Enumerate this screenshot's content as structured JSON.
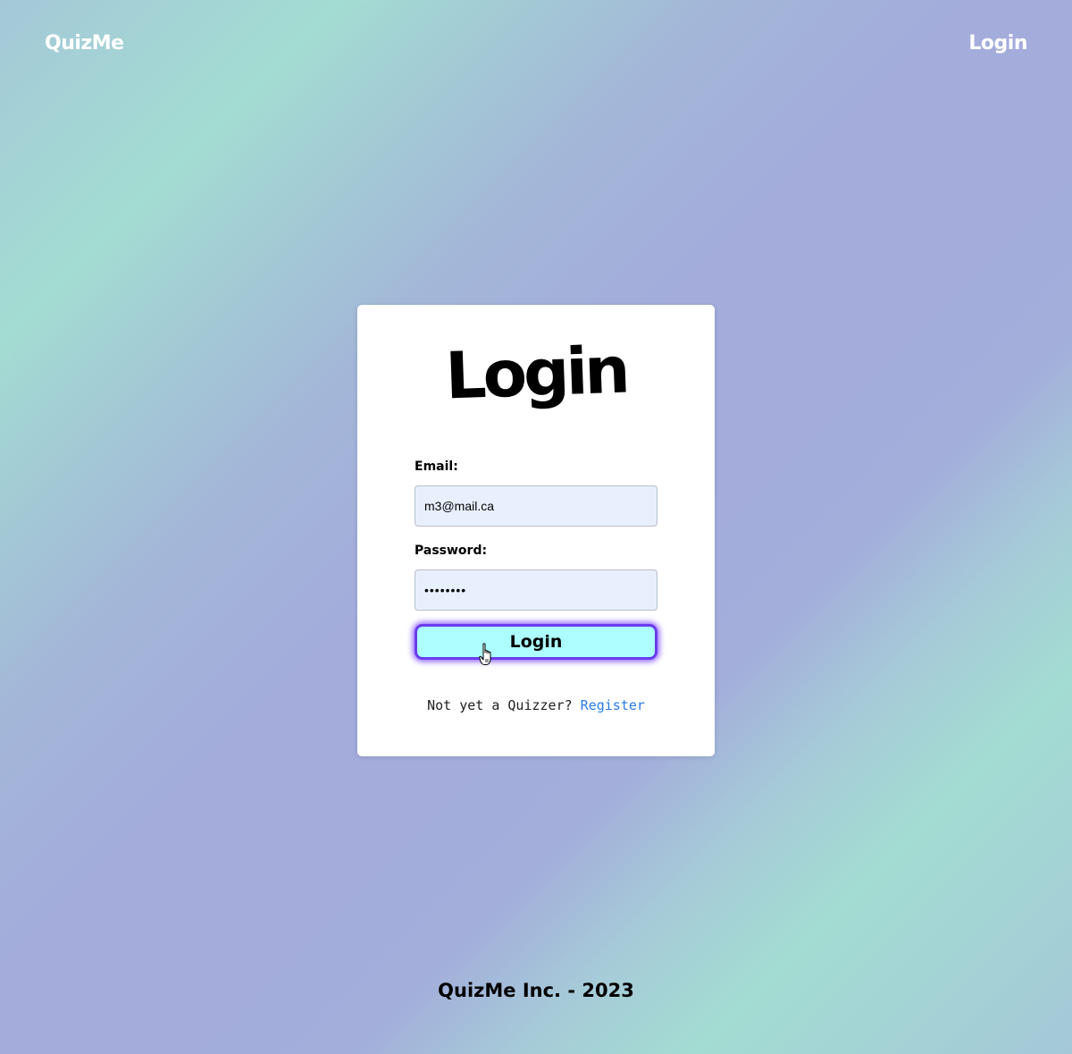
{
  "nav": {
    "brand": "QuizMe",
    "login_link": "Login"
  },
  "login_card": {
    "title": "Login",
    "email_label": "Email:",
    "email_value": "m3@mail.ca",
    "password_label": "Password:",
    "password_value": "••••••••",
    "submit_label": "Login",
    "register_prompt": "Not yet a Quizzer?",
    "register_link": "Register"
  },
  "footer": {
    "text": "QuizMe Inc. - 2023"
  },
  "colors": {
    "button_fill": "#adfefe",
    "button_border": "#6b3cf0",
    "link": "#2a7be0",
    "input_fill": "#e8f0fe"
  },
  "icons": {
    "cursor": "hand-pointer-icon"
  }
}
